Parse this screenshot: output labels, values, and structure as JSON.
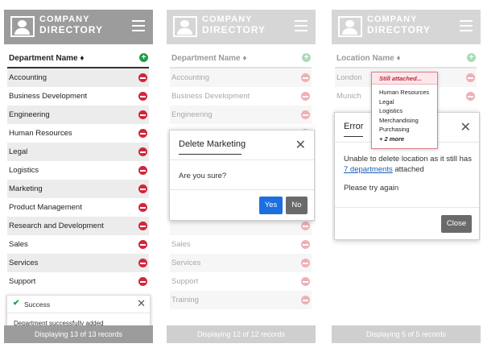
{
  "brand": {
    "line1": "COMPANY",
    "line2": "DIRECTORY"
  },
  "colors": {
    "header": "#9c9c9c",
    "add": "#1e9e4a",
    "delete": "#d0273a",
    "primary": "#1b6fe0",
    "secondary": "#6a6a6a"
  },
  "panel1": {
    "column_title": "Department Name ♦",
    "rows": [
      "Accounting",
      "Business Development",
      "Engineering",
      "Human Resources",
      "Legal",
      "Logistics",
      "Marketing",
      "Product Management",
      "Research and Development",
      "Sales",
      "Services",
      "Support"
    ],
    "toast": {
      "title": "Success",
      "message": "Department successfully added",
      "close": "✕",
      "check": "✔"
    },
    "footer": "Displaying 13 of 13 records"
  },
  "panel2": {
    "column_title": "Department Name ♦",
    "rows": [
      "Accounting",
      "Business Development",
      "Engineering",
      "",
      "",
      "",
      "",
      "",
      "",
      "Sales",
      "Services",
      "Support",
      "Training"
    ],
    "modal": {
      "title": "Delete Marketing",
      "body": "Are you sure?",
      "yes": "Yes",
      "no": "No",
      "close": "✕"
    },
    "footer": "Displaying 12 of 12 records"
  },
  "panel3": {
    "column_title": "Location Name ♦",
    "rows": [
      "London",
      "Munich"
    ],
    "tooltip": {
      "title": "Still attached...",
      "items": [
        "Human Resources",
        "Legal",
        "Logistics",
        "Merchandising",
        "Purchasing"
      ],
      "more": "+ 2 more"
    },
    "modal": {
      "title": "Error",
      "text_before": "Unable to delete location as it still has ",
      "link": "7 departments",
      "text_after": " attached",
      "retry": "Please try again",
      "close_button": "Close",
      "close": "✕"
    },
    "footer": "Displaying 5 of 5 records"
  }
}
